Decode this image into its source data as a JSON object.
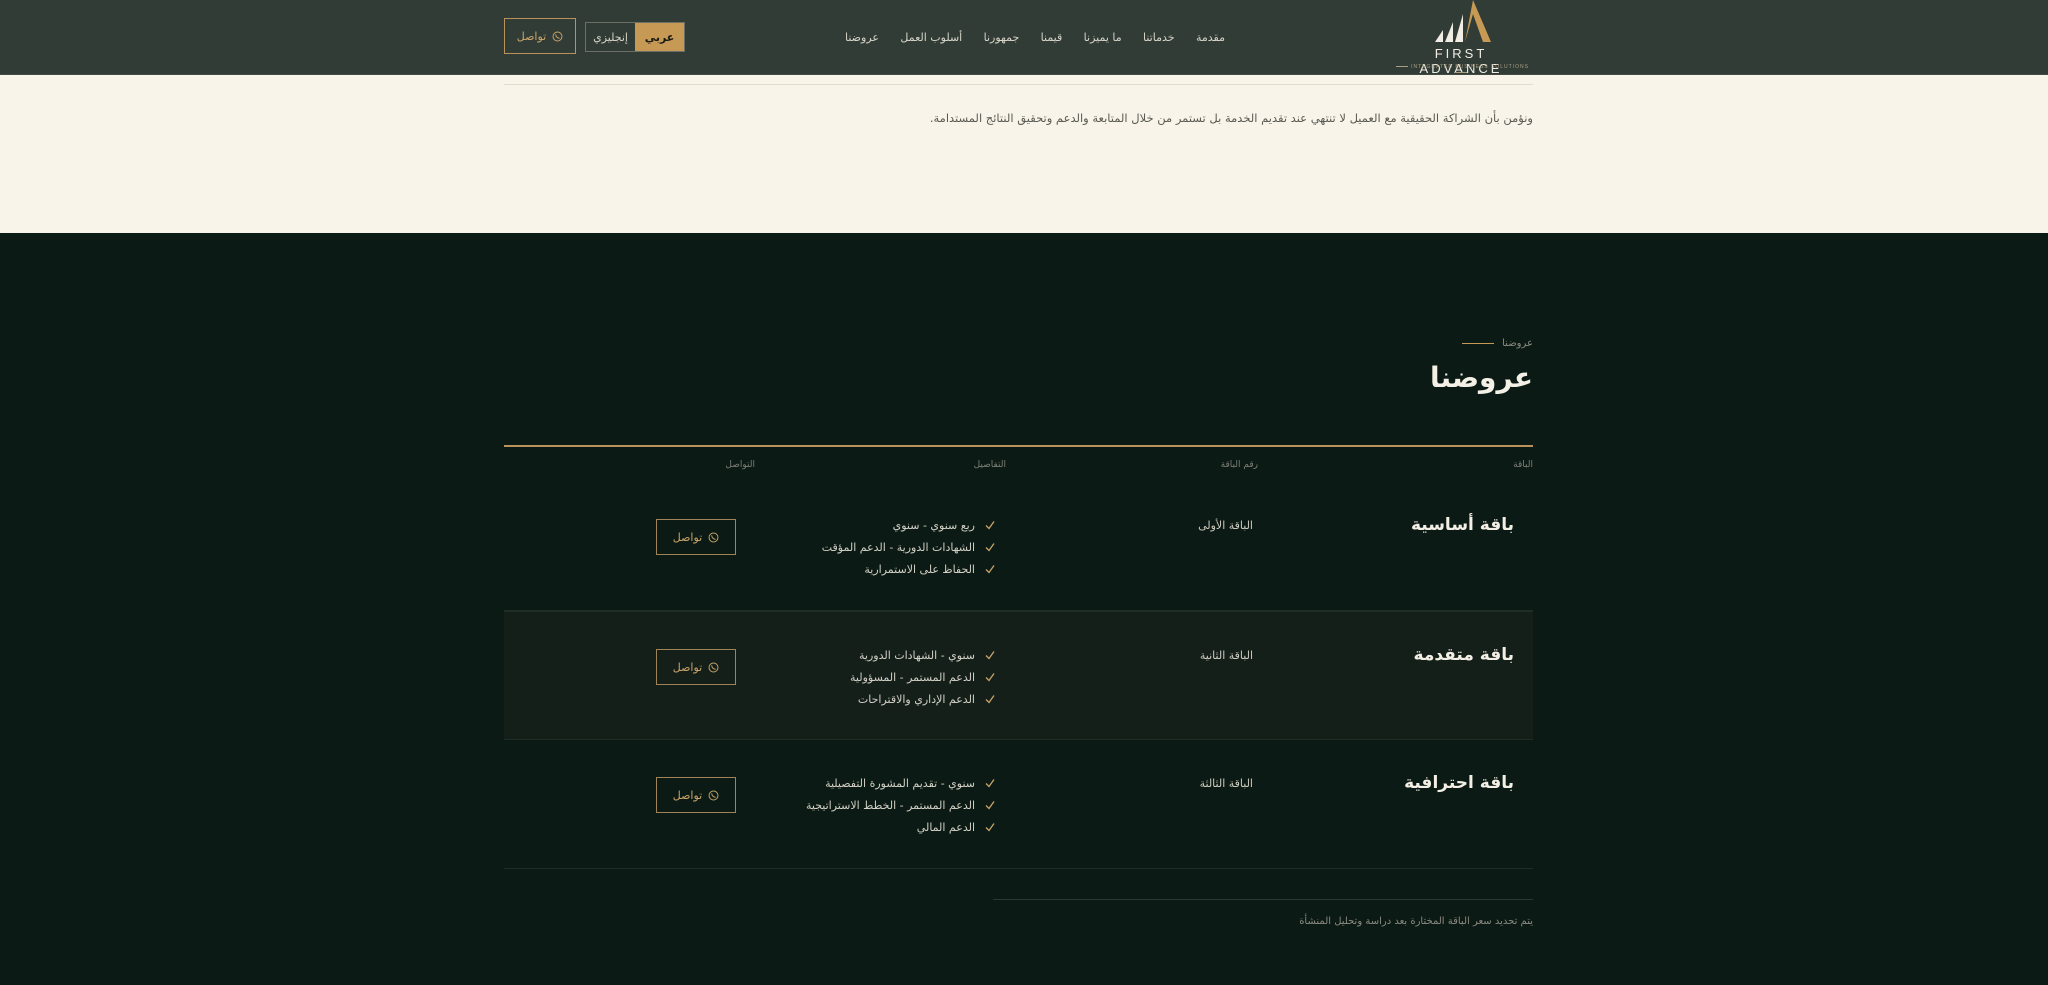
{
  "header": {
    "logo": {
      "name": "FIRST ADVANCE",
      "tagline": "INTEGRATED BUSINESS SOLUTIONS"
    },
    "nav": [
      "مقدمة",
      "خدماتنا",
      "ما يميزنا",
      "قيمنا",
      "جمهورنا",
      "أسلوب العمل",
      "عروضنا"
    ],
    "lang": {
      "arabic": "عربي",
      "english": "إنجليزي",
      "active": "arabic"
    },
    "contact_label": "تواصل",
    "contact_icon": "whatsapp-icon"
  },
  "intro": {
    "text": "ونؤمن بأن الشراكة الحقيقية مع العميل لا تنتهي عند تقديم الخدمة بل تستمر من خلال المتابعة والدعم وتحقيق النتائج المستدامة."
  },
  "offers": {
    "eyebrow": "عروضنا",
    "title": "عروضنا",
    "columns": {
      "package": "الباقة",
      "number": "رقم الباقة",
      "details": "التفاصيل",
      "contact": "التواصل"
    },
    "rows": [
      {
        "name": "باقة أساسية",
        "number": "الباقة الأولى",
        "features": [
          "ربع سنوي - سنوي",
          "الشهادات الدورية - الدعم المؤقت",
          "الحفاظ على الاستمرارية"
        ],
        "contact_label": "تواصل"
      },
      {
        "name": "باقة متقدمة",
        "number": "الباقة الثانية",
        "features": [
          "سنوي - الشهادات الدورية",
          "الدعم المستمر - المسؤولية",
          "الدعم الإداري والاقتراحات"
        ],
        "contact_label": "تواصل"
      },
      {
        "name": "باقة احترافية",
        "number": "الباقة الثالثة",
        "features": [
          "سنوي - تقديم المشورة التفصيلية",
          "الدعم المستمر - الخطط الاستراتيجية",
          "الدعم المالي"
        ],
        "contact_label": "تواصل"
      }
    ],
    "note": "يتم تحديد سعر الباقة المختارة بعد دراسة وتحليل المنشأة"
  },
  "colors": {
    "header_bg": "#323c36",
    "cream_bg": "#f8f4ea",
    "dark_bg": "#0b1a14",
    "accent_gold": "#c69a54"
  }
}
